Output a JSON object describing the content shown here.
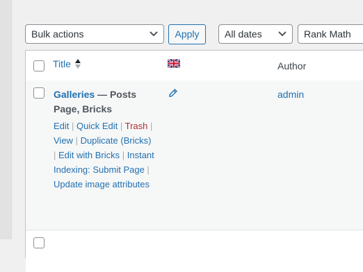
{
  "toolbar": {
    "bulk_actions": "Bulk actions",
    "apply_label": "Apply",
    "dates_filter": "All dates",
    "seo_filter": "Rank Math"
  },
  "table": {
    "columns": {
      "title": "Title",
      "language_flag": "uk-flag-icon",
      "author": "Author"
    },
    "rows": [
      {
        "title": "Galleries",
        "separator": " — ",
        "state": "Posts Page, Bricks",
        "author": "admin",
        "actions": {
          "edit": "Edit",
          "quick_edit": "Quick Edit",
          "trash": "Trash",
          "view": "View",
          "duplicate": "Duplicate (Bricks)",
          "edit_bricks": "Edit with Bricks",
          "instant_indexing": "Instant Indexing: Submit Page",
          "update_image": "Update image attributes"
        }
      }
    ]
  },
  "colors": {
    "link": "#2271b1",
    "trash": "#b32d2e",
    "border": "#c3c4c7",
    "row_hover": "#f6f7f7"
  }
}
